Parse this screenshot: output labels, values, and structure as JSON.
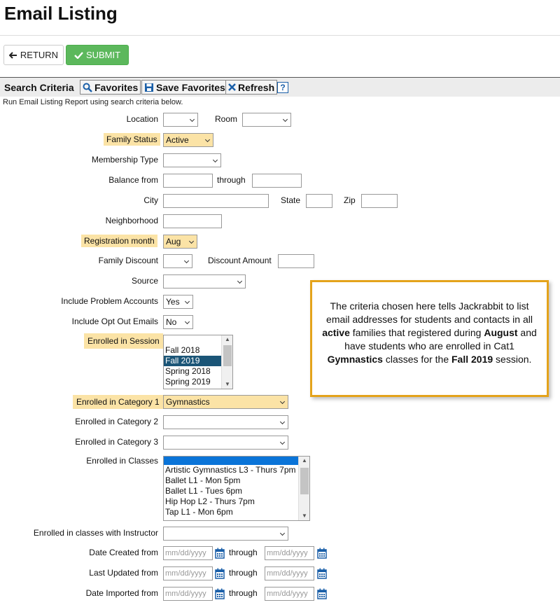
{
  "page": {
    "title": "Email Listing"
  },
  "toolbar": {
    "return_label": "RETURN",
    "submit_label": "SUBMIT"
  },
  "criteria": {
    "title": "Search Criteria",
    "favorites_label": "Favorites",
    "save_favorites_label": "Save Favorites",
    "refresh_label": "Refresh",
    "help_label": "?",
    "subtitle": "Run Email Listing Report using search criteria below."
  },
  "fields": {
    "location": {
      "label": "Location",
      "value": ""
    },
    "room": {
      "label": "Room",
      "value": ""
    },
    "family_status": {
      "label": "Family Status",
      "value": "Active"
    },
    "membership_type": {
      "label": "Membership Type",
      "value": ""
    },
    "balance_from": {
      "label": "Balance from",
      "through_label": "through"
    },
    "city": {
      "label": "City"
    },
    "state": {
      "label": "State"
    },
    "zip": {
      "label": "Zip"
    },
    "neighborhood": {
      "label": "Neighborhood"
    },
    "registration_month": {
      "label": "Registration month",
      "value": "Aug"
    },
    "family_discount": {
      "label": "Family Discount",
      "value": ""
    },
    "discount_amount": {
      "label": "Discount Amount"
    },
    "source": {
      "label": "Source",
      "value": ""
    },
    "include_problem_accounts": {
      "label": "Include Problem Accounts",
      "value": "Yes"
    },
    "include_opt_out_emails": {
      "label": "Include Opt Out Emails",
      "value": "No"
    },
    "enrolled_in_session": {
      "label": "Enrolled in Session",
      "options": [
        "Fall 2018",
        "Fall 2019",
        "Spring 2018",
        "Spring 2019"
      ],
      "selected": "Fall 2019"
    },
    "enrolled_in_category_1": {
      "label": "Enrolled in Category 1",
      "value": "Gymnastics"
    },
    "enrolled_in_category_2": {
      "label": "Enrolled in Category 2",
      "value": ""
    },
    "enrolled_in_category_3": {
      "label": "Enrolled in Category 3",
      "value": ""
    },
    "enrolled_in_classes": {
      "label": "Enrolled in Classes",
      "options": [
        "Artistic Gymnastics L3 - Thurs 7pm",
        "Ballet L1 - Mon 5pm",
        "Ballet L1 - Tues 6pm",
        "Hip Hop L2 - Thurs 7pm",
        "Tap L1 - Mon 6pm"
      ]
    },
    "enrolled_with_instructor": {
      "label": "Enrolled in classes with Instructor",
      "value": ""
    },
    "date_created": {
      "label": "Date Created from",
      "placeholder": "mm/dd/yyyy",
      "through_label": "through"
    },
    "last_updated": {
      "label": "Last Updated from",
      "placeholder": "mm/dd/yyyy",
      "through_label": "through"
    },
    "date_imported": {
      "label": "Date Imported from",
      "placeholder": "mm/dd/yyyy",
      "through_label": "through"
    }
  },
  "callout": {
    "t1": "The criteria chosen here tells Jackrabbit to list email addresses for students and contacts in all ",
    "b1": "active",
    "t2": " families that registered during ",
    "b2": "August",
    "t3": " and have students who are enrolled in Cat1 ",
    "b3": "Gymnastics",
    "t4": " classes for the ",
    "b4": "Fall 2019",
    "t5": " session."
  },
  "colors": {
    "submit_green": "#5cb85c",
    "highlight": "#fbe3a6",
    "callout_border": "#e4a31b",
    "selected_option": "#1b5577",
    "icon_blue": "#1a5fa8"
  }
}
